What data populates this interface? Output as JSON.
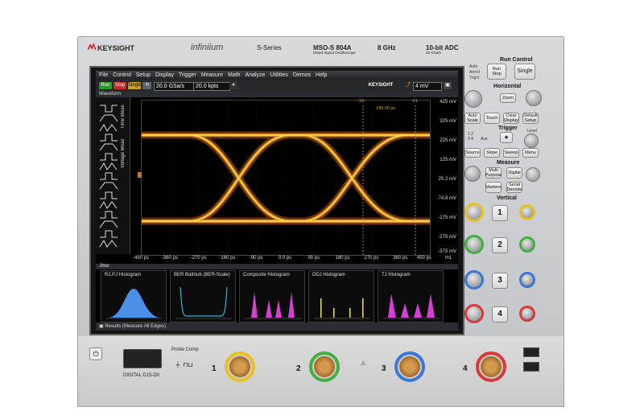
{
  "header": {
    "brand": "KEYSIGHT",
    "series_logo": "infiniium",
    "series": "S-Series",
    "model": "MSO-S 804A",
    "model_sub": "Mixed Signal Oscilloscope",
    "bandwidth": "8 GHz",
    "adc": "10-bit ADC",
    "adc_sub": "20 GSa/s"
  },
  "screen": {
    "menu": [
      "File",
      "Control",
      "Setup",
      "Display",
      "Trigger",
      "Measure",
      "Math",
      "Analyze",
      "Utilities",
      "Demos",
      "Help"
    ],
    "toolbar": {
      "run_label": "Run",
      "stop_label": "Stop",
      "single_label": "Single",
      "sample_rate": "20.0 GSa/s",
      "memory_depth": "20.0 kpts",
      "brand": "KEYSIGHT",
      "trigger_level": "4 mV"
    },
    "waveform_label": "Waveform",
    "side_tabs": [
      "Time Meas",
      "Voltage Meas"
    ],
    "cursor_labels": {
      "x2": "X2",
      "x1": "X1",
      "delta": "180.00 ps"
    },
    "y_axis": [
      "425 mV",
      "325 mV",
      "225 mV",
      "125 mV",
      "25.2 mV",
      "-74.8 mV",
      "-175 mV",
      "-275 mV",
      "-375 mV"
    ],
    "x_axis": [
      "-450 ps",
      "-360 ps",
      "-270 ps",
      "-180 ps",
      "-90 ps",
      "0.0 ps",
      "90 ps",
      "180 ps",
      "270 ps",
      "360 ps",
      "450 ps"
    ],
    "x_axis_end": "m1",
    "jitter_label": "Jitter",
    "histograms": [
      {
        "title": "RJ,PJ Histogram",
        "color": "#4a90e8"
      },
      {
        "title": "BER Bathtub (BER-Scale)",
        "color": "#2fb5d8"
      },
      {
        "title": "Composite Histogram",
        "color": "#d63fd6"
      },
      {
        "title": "DDJ Histogram",
        "color": "#e8e060"
      },
      {
        "title": "TJ Histogram",
        "color": "#d63fd6"
      }
    ],
    "results_label": "Results",
    "results_sub": "(Measure All Edges)"
  },
  "front_panel": {
    "run_control": "Run Control",
    "auto_label": "Auto",
    "arm_label": "Arm'd",
    "trigd_label": "Trig'd",
    "run_stop": "Run Stop",
    "single": "Single",
    "horizontal": "Horizontal",
    "zoom": "Zoom",
    "auto_scale": "Auto Scale",
    "touch": "Touch",
    "clear_display": "Clear Display",
    "default_setup": "Default Setup",
    "trigger": "Trigger",
    "aux_label": "Aux",
    "level_label": "Level",
    "source": "Source",
    "slope": "Slope",
    "sweep": "Sweep",
    "menu": "Menu",
    "measure": "Measure",
    "multi_purpose": "Multi Purpose",
    "digital": "Digital",
    "markers": "Markers",
    "serial_decode": "Serial Decode",
    "vertical": "Vertical",
    "channels": [
      "1",
      "2",
      "3",
      "4"
    ],
    "channel_colors": [
      "#e8c020",
      "#40b040",
      "#3a78d8",
      "#d83a3a"
    ]
  },
  "lower_panel": {
    "digital_label": "DIGITAL D15-D0",
    "probe_comp": "Probe Comp",
    "inputs": [
      "1",
      "2",
      "3",
      "4"
    ]
  }
}
